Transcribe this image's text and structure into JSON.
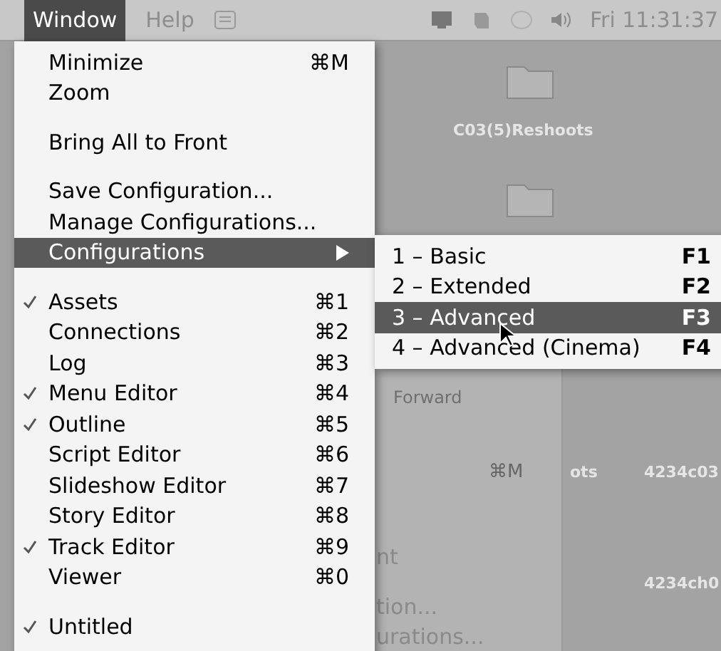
{
  "menubar": {
    "menus": [
      {
        "label": "Window",
        "selected": true
      },
      {
        "label": "Help",
        "selected": false
      }
    ],
    "clock": "Fri 11:31:37"
  },
  "desktop": {
    "folders": [
      {
        "label": "C03(5)Reshoots"
      },
      {
        "label": "4234c03"
      },
      {
        "label": "4234ch0"
      }
    ],
    "window_texts": [
      "Forward",
      "⌘M",
      "ots",
      "nt",
      "tion...",
      "urations..."
    ]
  },
  "menu": {
    "items": [
      {
        "kind": "item",
        "label": "Minimize",
        "shortcut": "⌘M",
        "checked": false,
        "selected": false
      },
      {
        "kind": "item",
        "label": "Zoom",
        "checked": false,
        "selected": false
      },
      {
        "kind": "separator"
      },
      {
        "kind": "item",
        "label": "Bring All to Front",
        "checked": false,
        "selected": false
      },
      {
        "kind": "separator"
      },
      {
        "kind": "item",
        "label": "Save Configuration...",
        "checked": false,
        "selected": false
      },
      {
        "kind": "item",
        "label": "Manage Configurations...",
        "checked": false,
        "selected": false
      },
      {
        "kind": "submenu",
        "label": "Configurations",
        "checked": false,
        "selected": true
      },
      {
        "kind": "separator"
      },
      {
        "kind": "item",
        "label": "Assets",
        "shortcut": "⌘1",
        "checked": true,
        "selected": false
      },
      {
        "kind": "item",
        "label": "Connections",
        "shortcut": "⌘2",
        "checked": false,
        "selected": false
      },
      {
        "kind": "item",
        "label": "Log",
        "shortcut": "⌘3",
        "checked": false,
        "selected": false
      },
      {
        "kind": "item",
        "label": "Menu Editor",
        "shortcut": "⌘4",
        "checked": true,
        "selected": false
      },
      {
        "kind": "item",
        "label": "Outline",
        "shortcut": "⌘5",
        "checked": true,
        "selected": false
      },
      {
        "kind": "item",
        "label": "Script Editor",
        "shortcut": "⌘6",
        "checked": false,
        "selected": false
      },
      {
        "kind": "item",
        "label": "Slideshow Editor",
        "shortcut": "⌘7",
        "checked": false,
        "selected": false
      },
      {
        "kind": "item",
        "label": "Story Editor",
        "shortcut": "⌘8",
        "checked": false,
        "selected": false
      },
      {
        "kind": "item",
        "label": "Track Editor",
        "shortcut": "⌘9",
        "checked": true,
        "selected": false
      },
      {
        "kind": "item",
        "label": "Viewer",
        "shortcut": "⌘0",
        "checked": false,
        "selected": false
      },
      {
        "kind": "separator"
      },
      {
        "kind": "item",
        "label": "Untitled",
        "checked": true,
        "selected": false
      }
    ]
  },
  "submenu": {
    "items": [
      {
        "label": "1 – Basic",
        "shortcut": "F1",
        "selected": false
      },
      {
        "label": "2 – Extended",
        "shortcut": "F2",
        "selected": false
      },
      {
        "label": "3 – Advanced",
        "shortcut": "F3",
        "selected": true
      },
      {
        "label": "4 – Advanced (Cinema)",
        "shortcut": "F4",
        "selected": false
      }
    ]
  }
}
